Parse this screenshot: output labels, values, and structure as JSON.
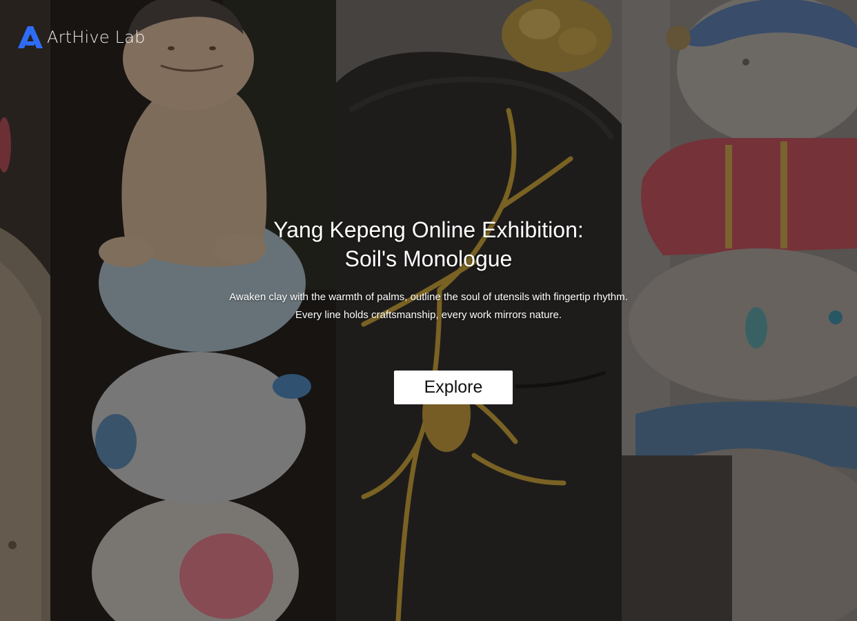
{
  "brand": {
    "name": "ArtHive Lab",
    "logo_icon": "stylized-a-logo-icon",
    "accent": "#2f6cf5"
  },
  "hero": {
    "title_line1": "Yang Kepeng Online Exhibition:",
    "title_line2": "Soil's Monologue",
    "desc_line1": "Awaken clay with the warmth of palms, outline the soul of utensils with fingertip rhythm.",
    "desc_line2": "Every line holds craftsmanship, every work mirrors nature.",
    "cta_label": "Explore"
  },
  "gallery": {
    "panels": [
      "ceramic-sculpture-1",
      "ceramic-figure-stack",
      "kintsugi-vessel",
      "ceramic-bear-stack"
    ]
  }
}
